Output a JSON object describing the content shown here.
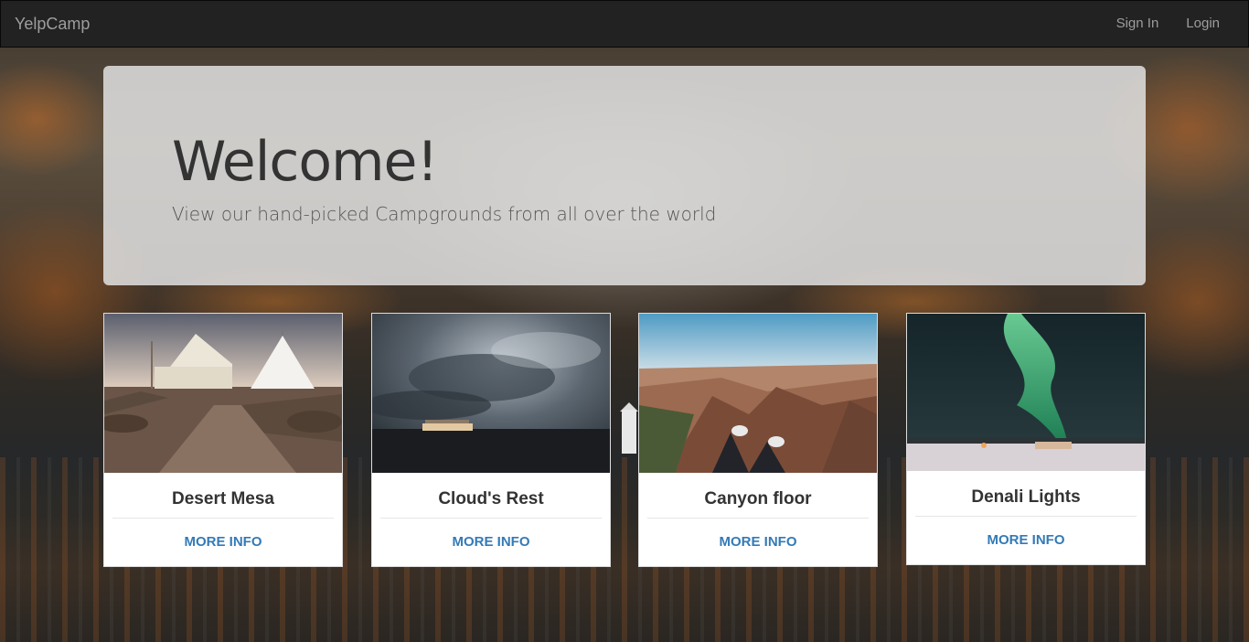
{
  "navbar": {
    "brand": "YelpCamp",
    "links": [
      "Sign In",
      "Login"
    ]
  },
  "jumbotron": {
    "heading": "Welcome!",
    "subheading": "View our hand-picked Campgrounds from all over the world"
  },
  "campgrounds": [
    {
      "name": "Desert Mesa",
      "action": "MORE INFO",
      "image": "tents-in-desert"
    },
    {
      "name": "Cloud's Rest",
      "action": "MORE INFO",
      "image": "stormy-sky-house"
    },
    {
      "name": "Canyon floor",
      "action": "MORE INFO",
      "image": "canyon-feet"
    },
    {
      "name": "Denali Lights",
      "action": "MORE INFO",
      "image": "aurora-borealis"
    }
  ],
  "colors": {
    "navbar_bg": "#222222",
    "navbar_text": "#9d9d9d",
    "link": "#337ab7",
    "jumbotron_bg": "rgba(225,225,225,0.86)"
  }
}
